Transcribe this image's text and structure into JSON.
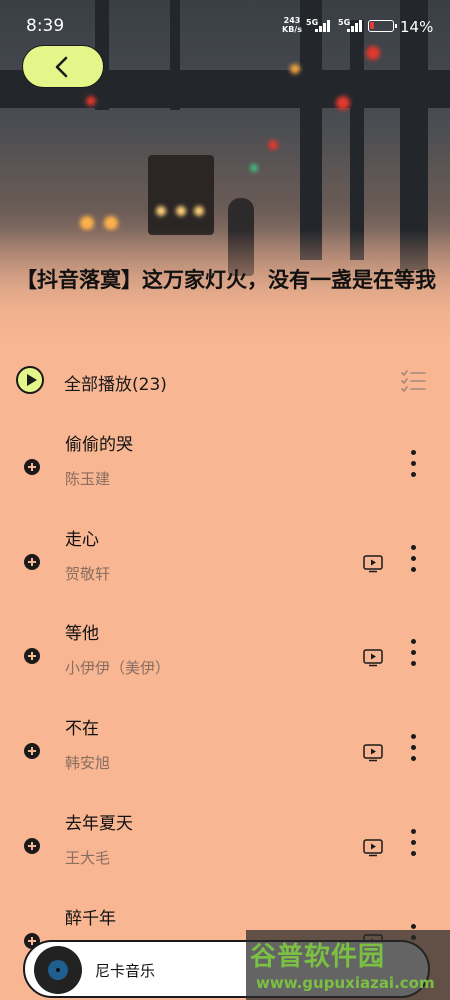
{
  "status_bar": {
    "time": "8:39",
    "speed_value": "243",
    "speed_unit": "KB/s",
    "network_1": "5G",
    "network_2": "5G",
    "battery_percent": "14%"
  },
  "playlist": {
    "title": "【抖音落寞】这万家灯火，没有一盏是在等我",
    "play_all_label": "全部播放(23)"
  },
  "songs": [
    {
      "name": "偷偷的哭",
      "artist": "陈玉建",
      "has_mv": false
    },
    {
      "name": "走心",
      "artist": "贺敬轩",
      "has_mv": true
    },
    {
      "name": "等他",
      "artist": "小伊伊（美伊）",
      "has_mv": true
    },
    {
      "name": "不在",
      "artist": "韩安旭",
      "has_mv": true
    },
    {
      "name": "去年夏天",
      "artist": "王大毛",
      "has_mv": true
    },
    {
      "name": "醉千年",
      "artist": "",
      "has_mv": true
    }
  ],
  "player": {
    "name": "尼卡音乐"
  },
  "watermark": {
    "brand": "谷普软件园",
    "url": "www.gupuxiazai.com"
  },
  "colors": {
    "background": "#f8b692",
    "accent": "#e4f68a",
    "watermark_green": "#7bc043"
  }
}
